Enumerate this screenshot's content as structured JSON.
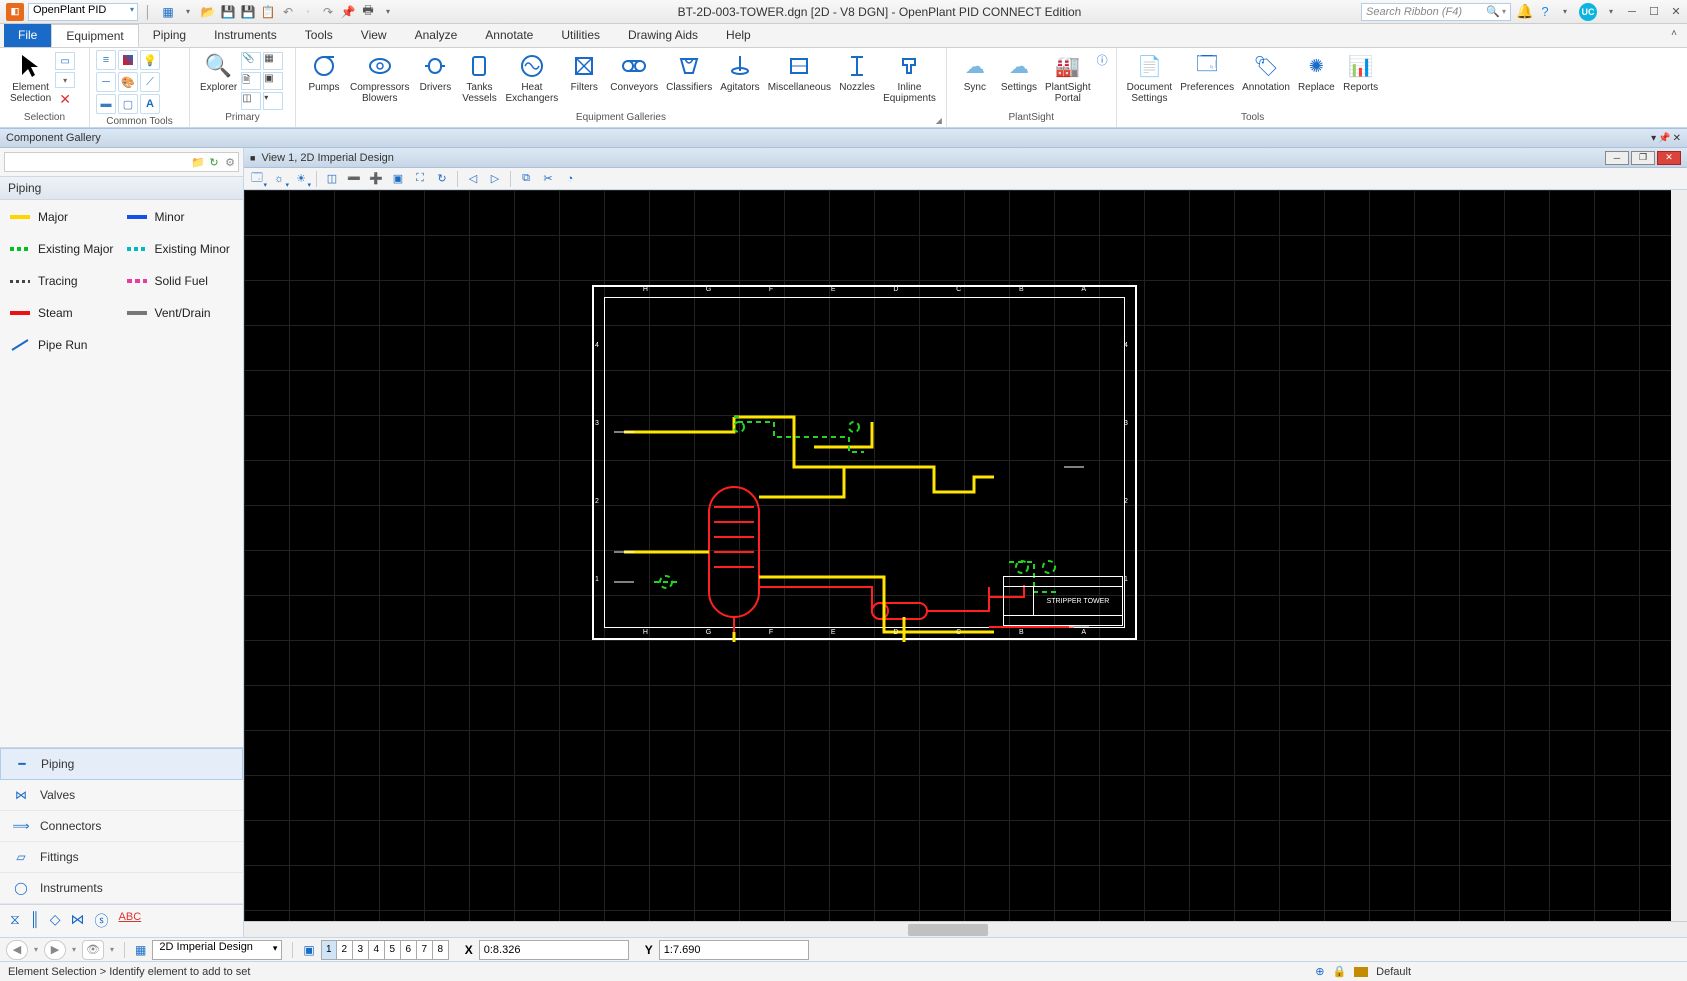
{
  "titlebar": {
    "app_combo": "OpenPlant PID",
    "document_title": "BT-2D-003-TOWER.dgn [2D - V8 DGN] - OpenPlant PID CONNECT Edition",
    "search_placeholder": "Search Ribbon (F4)",
    "user_badge": "UC"
  },
  "ribbon_tabs": {
    "file": "File",
    "tabs": [
      "Equipment",
      "Piping",
      "Instruments",
      "Tools",
      "View",
      "Analyze",
      "Annotate",
      "Utilities",
      "Drawing Aids",
      "Help"
    ],
    "active_index": 0
  },
  "ribbon": {
    "selection": {
      "element_selection": "Element\nSelection",
      "group_label": "Selection"
    },
    "common_tools": {
      "explorer": "Explorer",
      "group_label": "Common Tools"
    },
    "primary": {
      "group_label": "Primary"
    },
    "galleries": {
      "items": [
        "Pumps",
        "Compressors\nBlowers",
        "Drivers",
        "Tanks\nVessels",
        "Heat\nExchangers",
        "Filters",
        "Conveyors",
        "Classifiers",
        "Agitators",
        "Miscellaneous",
        "Nozzles",
        "Inline\nEquipments"
      ],
      "group_label": "Equipment Galleries"
    },
    "plantsight": {
      "items": [
        "Sync",
        "Settings",
        "PlantSight\nPortal"
      ],
      "group_label": "PlantSight"
    },
    "tools": {
      "items": [
        "Document\nSettings",
        "Preferences",
        "Annotation",
        "Replace",
        "Reports"
      ],
      "group_label": "Tools"
    }
  },
  "panel_strip": {
    "title": "Component Gallery"
  },
  "sidebar": {
    "category_header": "Piping",
    "items": [
      {
        "label": "Major",
        "color": "#ffd500",
        "style": "solid"
      },
      {
        "label": "Minor",
        "color": "#1452e6",
        "style": "solid"
      },
      {
        "label": "Existing Major",
        "color": "#00c221",
        "style": "dashed"
      },
      {
        "label": "Existing Minor",
        "color": "#00bcc2",
        "style": "dashed"
      },
      {
        "label": "Tracing",
        "color": "#444",
        "style": "dashed-thin"
      },
      {
        "label": "Solid Fuel",
        "color": "#e83ba3",
        "style": "dashed"
      },
      {
        "label": "Steam",
        "color": "#e11",
        "style": "solid"
      },
      {
        "label": "Vent/Drain",
        "color": "#777",
        "style": "solid"
      },
      {
        "label": "Pipe Run",
        "color": "#1a6bc7",
        "style": "diag"
      }
    ],
    "nav": [
      "Piping",
      "Valves",
      "Connectors",
      "Fittings",
      "Instruments"
    ],
    "nav_selected": 0
  },
  "view": {
    "title": "View 1, 2D Imperial Design",
    "titleblock_text": "STRIPPER TOWER"
  },
  "coord_bar": {
    "design_combo": "2D Imperial Design",
    "view_numbers": [
      "1",
      "2",
      "3",
      "4",
      "5",
      "6",
      "7",
      "8"
    ],
    "active_view": 0,
    "x_label": "X",
    "x_value": "0:8.326",
    "y_label": "Y",
    "y_value": "1:7.690"
  },
  "status_bar": {
    "prompt": "Element Selection > Identify element to add to set",
    "level_label": "Default"
  }
}
